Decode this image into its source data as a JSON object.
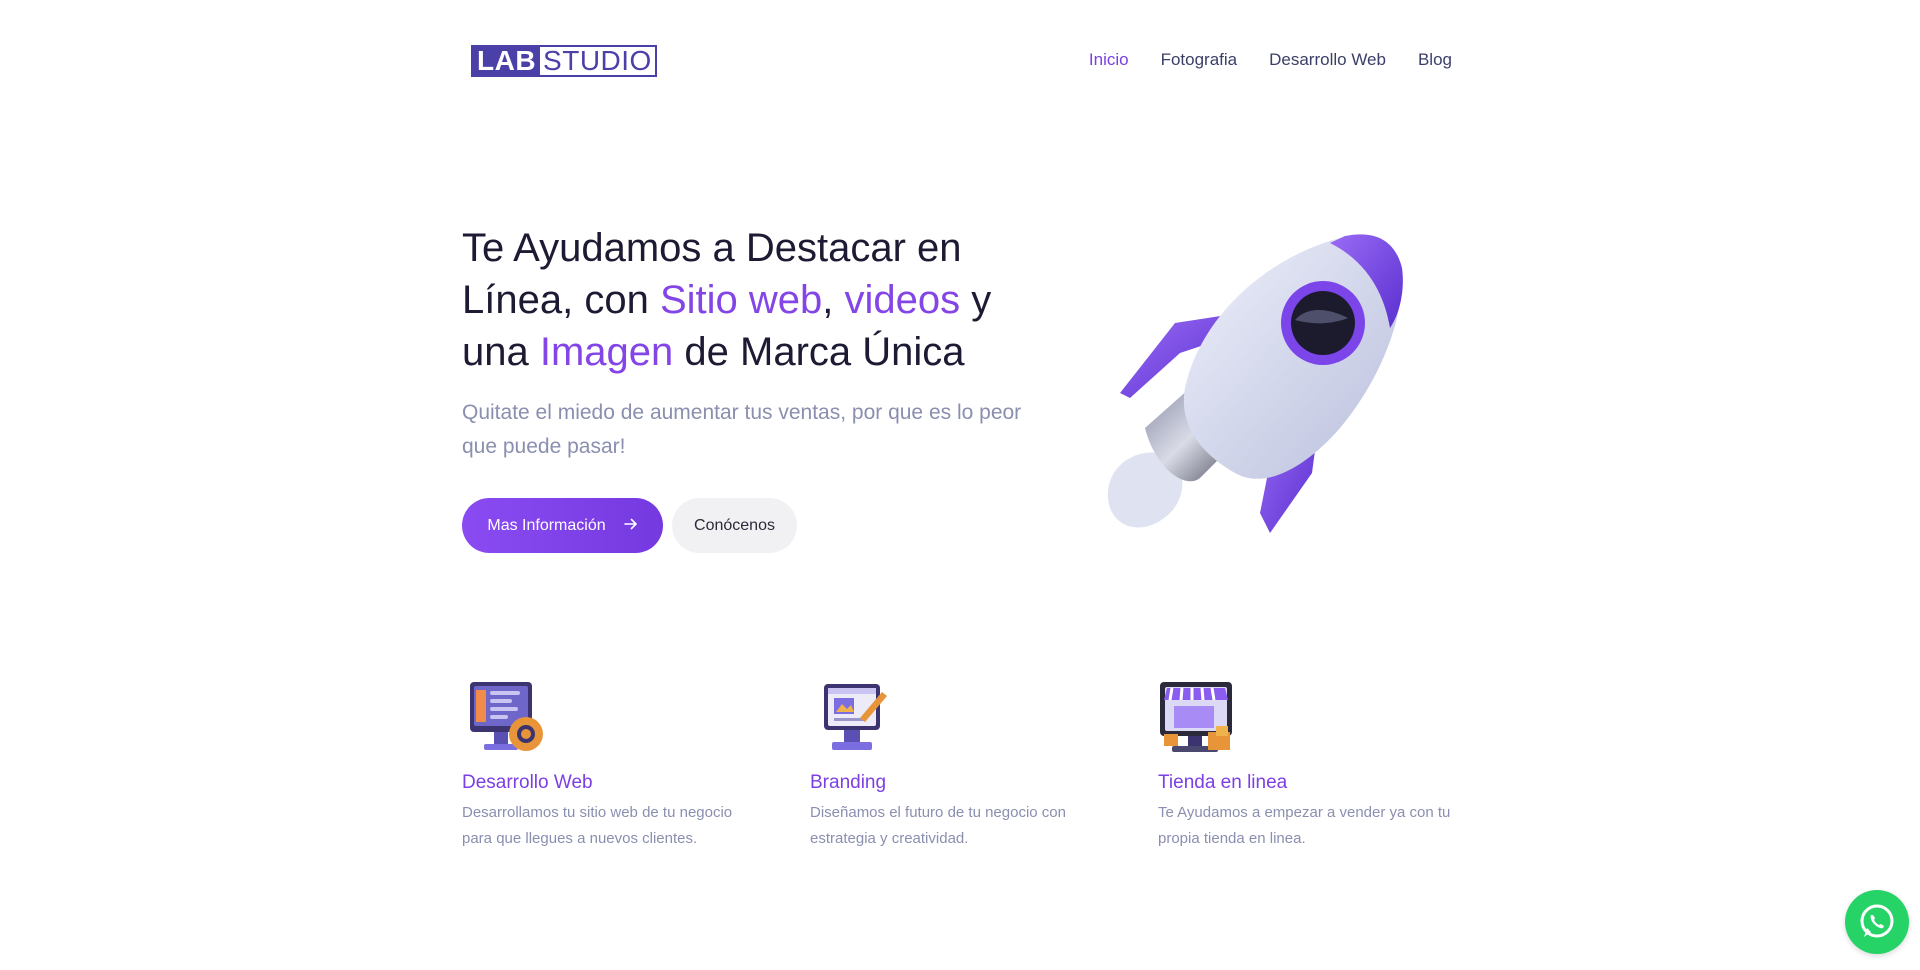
{
  "header": {
    "logo": {
      "part1": "LAB",
      "part2": "STUDIO"
    },
    "nav": [
      {
        "label": "Inicio",
        "active": true
      },
      {
        "label": "Fotografia",
        "active": false
      },
      {
        "label": "Desarrollo Web",
        "active": false
      },
      {
        "label": "Blog",
        "active": false
      }
    ]
  },
  "hero": {
    "title": {
      "t1": "Te Ayudamos a Destacar en Línea, con ",
      "a1": "Sitio web",
      "t2": ", ",
      "a2": "videos",
      "t3": " y una ",
      "a3": "Imagen",
      "t4": " de Marca Única"
    },
    "subtitle": "Quitate el miedo de aumentar tus ventas, por que es lo peor que puede pasar!",
    "primary_button": "Mas Información",
    "secondary_button": "Conócenos",
    "illustration_icon": "rocket-icon"
  },
  "services": [
    {
      "title": "Desarrollo Web",
      "description": "Desarrollamos tu sitio web de tu negocio para que llegues a nuevos clientes.",
      "icon": "web-development-icon"
    },
    {
      "title": "Branding",
      "description": "Diseñamos el futuro de tu negocio con estrategia y creatividad.",
      "icon": "branding-icon"
    },
    {
      "title": "Tienda en linea",
      "description": "Te Ayudamos a empezar a vender ya con tu propia tienda en linea.",
      "icon": "online-store-icon"
    }
  ],
  "floating": {
    "icon": "whatsapp-icon",
    "color": "#25d366"
  },
  "colors": {
    "accent": "#7b3fe4",
    "brand": "#4b3fa8",
    "text": "#1c1b33",
    "muted": "#8a8fb0"
  }
}
